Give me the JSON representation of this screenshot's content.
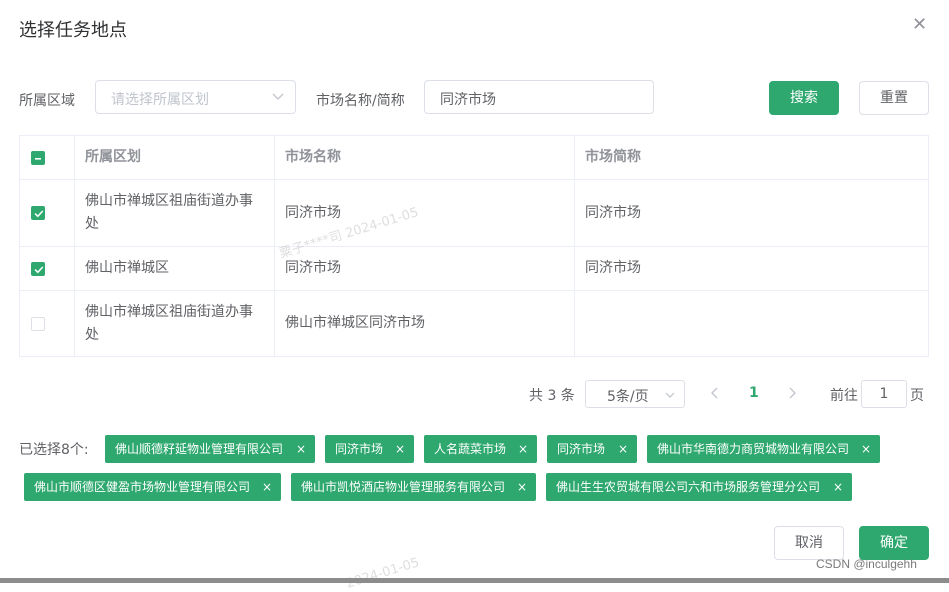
{
  "dialog": {
    "title": "选择任务地点",
    "close_icon": "close-icon"
  },
  "filters": {
    "region_label": "所属区域",
    "region_placeholder": "请选择所属区划",
    "market_label": "市场名称/简称",
    "market_value": "同济市场",
    "search_label": "搜索",
    "reset_label": "重置"
  },
  "table": {
    "headers": [
      "所属区划",
      "市场名称",
      "市场简称"
    ],
    "rows": [
      {
        "checked": true,
        "region": "佛山市禅城区祖庙街道办事处",
        "name": "同济市场",
        "short": "同济市场"
      },
      {
        "checked": true,
        "region": "佛山市禅城区",
        "name": "同济市场",
        "short": "同济市场"
      },
      {
        "checked": false,
        "region": "佛山市禅城区祖庙街道办事处",
        "name": "佛山市禅城区同济市场",
        "short": ""
      }
    ]
  },
  "pagination": {
    "total": "共 3 条",
    "page_size": "5条/页",
    "current_page": "1",
    "goto_prefix": "前往",
    "goto_value": "1",
    "goto_suffix": "页"
  },
  "selected": {
    "label": "已选择8个:",
    "tags": [
      "佛山顺德籽延物业管理有限公司",
      "同济市场",
      "人名蔬菜市场",
      "同济市场",
      "佛山市华南德力商贸城物业有限公司",
      "佛山市顺德区健盈市场物业管理有限公司",
      "佛山市凯悦酒店物业管理服务有限公司",
      "佛山生生农贸城有限公司六和市场服务管理分公司"
    ],
    "tag_close": "×"
  },
  "footer": {
    "cancel_label": "取消",
    "confirm_label": "确定"
  },
  "watermarks": {
    "text1": "粟子****司 2024-01-05",
    "text2": "2024-01-05",
    "csdn": "CSDN @inculgehh"
  },
  "colors": {
    "primary": "#2ea86f",
    "border": "#dcdfe6",
    "text": "#606266"
  }
}
